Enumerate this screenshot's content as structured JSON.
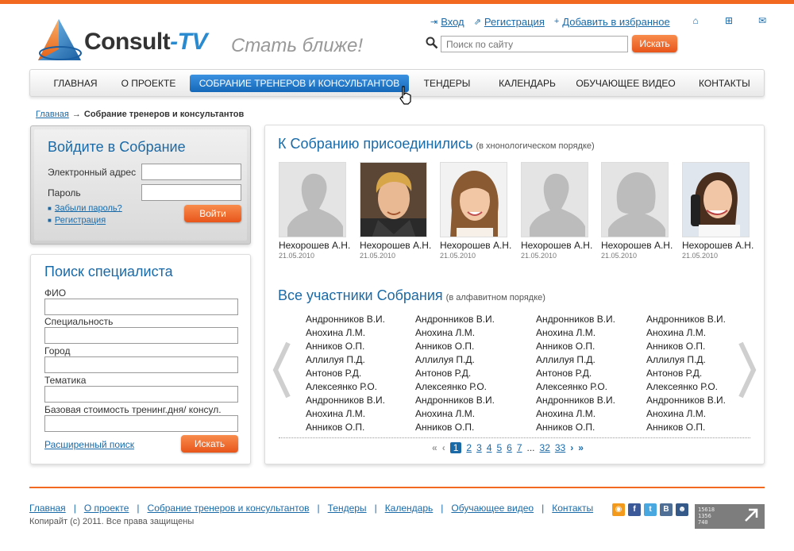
{
  "brand": {
    "name_main": "Consult",
    "name_dash": "-",
    "name_accent": "TV",
    "slogan": "Стать ближе!"
  },
  "top_links": [
    {
      "icon": "login-icon",
      "glyph": "⇥",
      "label": "Вход"
    },
    {
      "icon": "register-icon",
      "glyph": "⇗",
      "label": "Регистрация"
    },
    {
      "icon": "plus-icon",
      "glyph": "+",
      "label": "Добавить в избранное"
    }
  ],
  "top_icons": [
    {
      "name": "home-icon",
      "glyph": "⌂"
    },
    {
      "name": "sitemap-icon",
      "glyph": "⊞"
    },
    {
      "name": "mail-icon",
      "glyph": "✉"
    }
  ],
  "search": {
    "placeholder": "Поиск по сайту",
    "button": "Искать"
  },
  "nav": {
    "items": [
      {
        "label": "ГЛАВНАЯ",
        "active": false
      },
      {
        "label": "О ПРОЕКТЕ",
        "active": false
      },
      {
        "label": "СОБРАНИЕ ТРЕНЕРОВ И КОНСУЛЬТАНТОВ",
        "active": true
      },
      {
        "label": "ТЕНДЕРЫ",
        "active": false
      },
      {
        "label": "КАЛЕНДАРЬ",
        "active": false
      },
      {
        "label": "ОБУЧАЮЩЕЕ ВИДЕО",
        "active": false
      },
      {
        "label": "КОНТАКТЫ",
        "active": false
      }
    ]
  },
  "breadcrumb": {
    "home": "Главная",
    "arrow": "→",
    "current": "Собрание тренеров и консультантов"
  },
  "login": {
    "title": "Войдите в Собрание",
    "email_label": "Электронный адрес",
    "password_label": "Пароль",
    "forgot": "Забыли пароль?",
    "register": "Регистрация",
    "button": "Войти"
  },
  "specialist_search": {
    "title": "Поиск специалиста",
    "fields": [
      "ФИО",
      "Специальность",
      "Город",
      "Тематика",
      "Базовая стоимость тренинг.дня/ консул."
    ],
    "advanced": "Расширенный  поиск",
    "button": "Искать"
  },
  "joined": {
    "title": "К Собранию присоединились",
    "note": "(в хнонологическом порядке)",
    "members": [
      {
        "name": "Нехорошев А.Н.",
        "date": "21.05.2010",
        "photo": "placeholder-male"
      },
      {
        "name": "Нехорошев А.Н.",
        "date": "21.05.2010",
        "photo": "man"
      },
      {
        "name": "Нехорошев А.Н.",
        "date": "21.05.2010",
        "photo": "woman"
      },
      {
        "name": "Нехорошев А.Н.",
        "date": "21.05.2010",
        "photo": "placeholder-male"
      },
      {
        "name": "Нехорошев А.Н.",
        "date": "21.05.2010",
        "photo": "placeholder-female"
      },
      {
        "name": "Нехорошев А.Н.",
        "date": "21.05.2010",
        "photo": "woman-phone"
      }
    ]
  },
  "all_members": {
    "title": "Все участники Собрания",
    "note": "(в алфавитном порядке)",
    "columns": [
      [
        "Андронников В.И.",
        "Анохина Л.М.",
        "Анников О.П.",
        "Аллилуя П.Д.",
        "Антонов Р.Д.",
        "Алексеянко Р.О.",
        "Андронников В.И.",
        "Анохина Л.М.",
        "Анников О.П."
      ],
      [
        "Андронников В.И.",
        "Анохина Л.М.",
        "Анников О.П.",
        "Аллилуя П.Д.",
        "Антонов Р.Д.",
        "Алексеянко Р.О.",
        "Андронников В.И.",
        "Анохина Л.М.",
        "Анников О.П."
      ],
      [
        "Андронников В.И.",
        "Анохина Л.М.",
        "Анников О.П.",
        "Аллилуя П.Д.",
        "Антонов Р.Д.",
        "Алексеянко Р.О.",
        "Андронников В.И.",
        "Анохина Л.М.",
        "Анников О.П."
      ],
      [
        "Андронников В.И.",
        "Анохина Л.М.",
        "Анников О.П.",
        "Аллилуя П.Д.",
        "Антонов Р.Д.",
        "Алексеянко Р.О.",
        "Андронников В.И.",
        "Анохина Л.М.",
        "Анников О.П."
      ]
    ]
  },
  "pager": {
    "first": "«",
    "prev": "‹",
    "pages": [
      "1",
      "2",
      "3",
      "4",
      "5",
      "6",
      "7"
    ],
    "current": "1",
    "ellipsis": "...",
    "last_pages": [
      "32",
      "33"
    ],
    "next": "›",
    "last": "»"
  },
  "footer": {
    "links": [
      "Главная",
      "О проекте",
      "Собрание тренеров и консультантов",
      "Тендеры",
      "Календарь",
      "Обучающее видео",
      "Контакты"
    ],
    "separator": "|",
    "copyright": "Копирайт (с) 2011. Все права защищены",
    "socials": [
      {
        "name": "rss-icon",
        "glyph": "◉",
        "color": "#f39a1d"
      },
      {
        "name": "facebook-icon",
        "glyph": "f",
        "color": "#3b5998"
      },
      {
        "name": "twitter-icon",
        "glyph": "t",
        "color": "#4aa8e0"
      },
      {
        "name": "vkontakte-icon",
        "glyph": "B",
        "color": "#4f6f96"
      },
      {
        "name": "person-icon",
        "glyph": "☻",
        "color": "#355a8a"
      }
    ],
    "counter": [
      "15618",
      "1356",
      "740"
    ]
  },
  "colors": {
    "accent": "#f26a21",
    "link": "#1a6aa8",
    "nav_active": "#1e74c6"
  }
}
